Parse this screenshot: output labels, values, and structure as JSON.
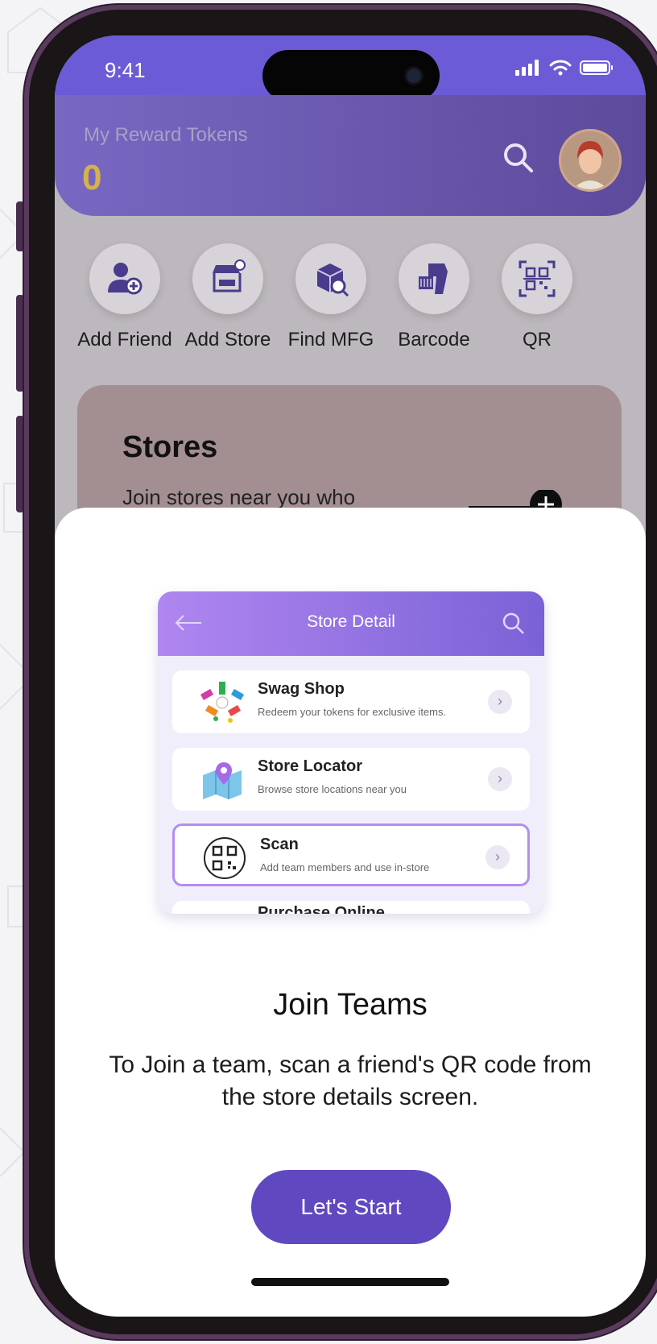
{
  "status_bar": {
    "time": "9:41"
  },
  "header": {
    "label": "My Reward Tokens",
    "value": "0"
  },
  "quick_actions": [
    {
      "label": "Add Friend",
      "icon": "add-friend-icon"
    },
    {
      "label": "Add Store",
      "icon": "add-store-icon"
    },
    {
      "label": "Find MFG",
      "icon": "find-mfg-icon"
    },
    {
      "label": "Barcode",
      "icon": "barcode-scanner-icon"
    },
    {
      "label": "QR",
      "icon": "qr-code-icon"
    }
  ],
  "stores_card": {
    "title": "Stores",
    "text": "Join stores near you who"
  },
  "preview": {
    "title": "Store Detail",
    "items": [
      {
        "name": "Swag Shop",
        "desc": "Redeem your tokens for exclusive items."
      },
      {
        "name": "Store Locator",
        "desc": "Browse store locations near you"
      },
      {
        "name": "Scan",
        "desc": "Add team members and use in-store"
      },
      {
        "name": "Purchase Online",
        "desc": ""
      }
    ]
  },
  "sheet": {
    "title": "Join Teams",
    "text": "To Join a team, scan a friend's QR code from the store details screen.",
    "button": "Let's Start"
  },
  "colors": {
    "primary": "#6048c0",
    "header": "#6b5bd6",
    "token": "#d6b24a"
  }
}
